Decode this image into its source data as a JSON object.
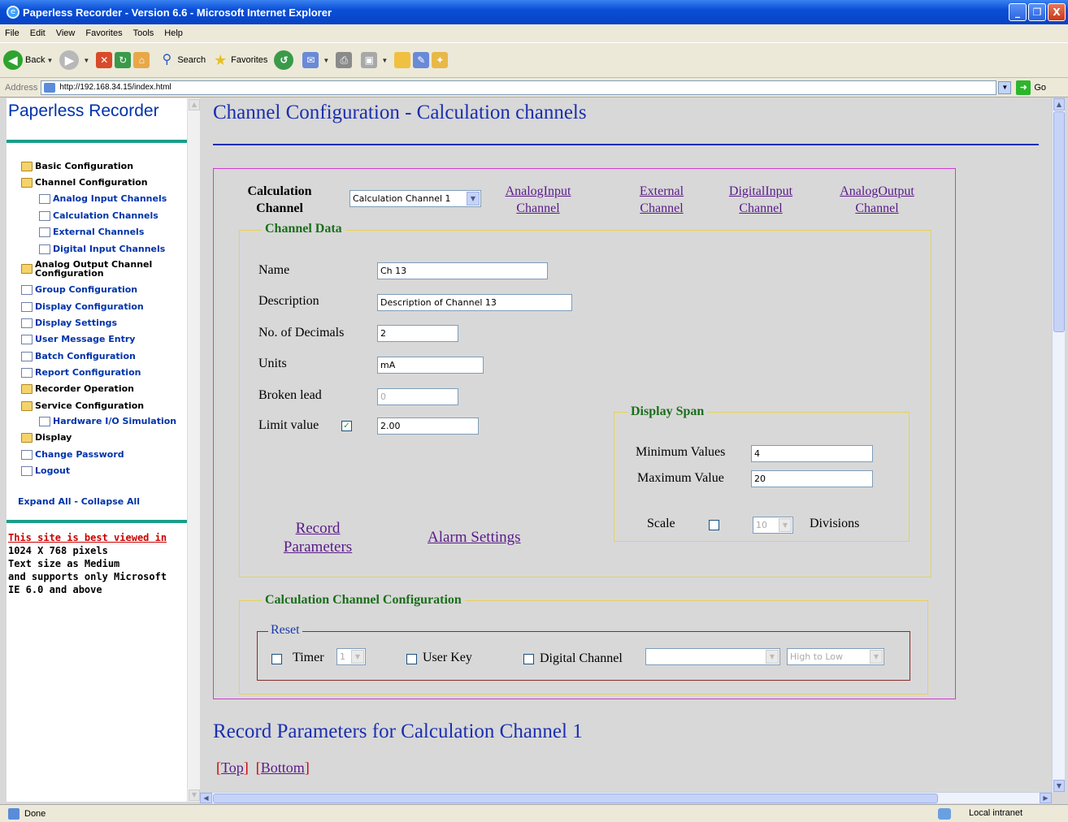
{
  "window": {
    "title": "Paperless Recorder - Version 6.6 - Microsoft Internet Explorer",
    "controls": {
      "minimize": "_",
      "maximize": "❐",
      "close": "X"
    }
  },
  "menubar": {
    "items": [
      "File",
      "Edit",
      "View",
      "Favorites",
      "Tools",
      "Help"
    ]
  },
  "toolbar": {
    "back": "Back",
    "search": "Search",
    "favorites": "Favorites"
  },
  "addressbar": {
    "label": "Address",
    "url": "http://192.168.34.15/index.html",
    "go": "Go"
  },
  "sidebar": {
    "title": "Paperless Recorder",
    "items": [
      {
        "label": "Basic Configuration",
        "icon": "folder-icon",
        "level": 0,
        "link": false
      },
      {
        "label": "Channel Configuration",
        "icon": "folder-icon",
        "level": 0,
        "link": false
      },
      {
        "label": "Analog Input Channels",
        "icon": "document-icon",
        "level": 1,
        "link": true
      },
      {
        "label": "Calculation Channels",
        "icon": "document-icon",
        "level": 1,
        "link": true
      },
      {
        "label": "External Channels",
        "icon": "document-icon",
        "level": 1,
        "link": true
      },
      {
        "label": "Digital Input Channels",
        "icon": "document-icon",
        "level": 1,
        "link": true
      },
      {
        "label": "Analog Output Channel Configuration",
        "icon": "folder-icon",
        "level": 0,
        "link": false
      },
      {
        "label": "Group Configuration",
        "icon": "document-icon",
        "level": 0,
        "link": true
      },
      {
        "label": "Display Configuration",
        "icon": "document-icon",
        "level": 0,
        "link": true
      },
      {
        "label": "Display Settings",
        "icon": "document-icon",
        "level": 0,
        "link": true
      },
      {
        "label": "User Message Entry",
        "icon": "document-icon",
        "level": 0,
        "link": true
      },
      {
        "label": "Batch Configuration",
        "icon": "document-icon",
        "level": 0,
        "link": true
      },
      {
        "label": "Report Configuration",
        "icon": "document-icon",
        "level": 0,
        "link": true
      },
      {
        "label": "Recorder Operation",
        "icon": "folder-icon",
        "level": 0,
        "link": false
      },
      {
        "label": "Service Configuration",
        "icon": "folder-icon",
        "level": 0,
        "link": false
      },
      {
        "label": "Hardware I/O Simulation",
        "icon": "document-icon",
        "level": 1,
        "link": true
      },
      {
        "label": "Display",
        "icon": "folder-icon",
        "level": 0,
        "link": false
      },
      {
        "label": "Change Password",
        "icon": "document-icon",
        "level": 0,
        "link": true
      },
      {
        "label": "Logout",
        "icon": "document-icon",
        "level": 0,
        "link": true
      }
    ],
    "expand_collapse": "Expand All - Collapse All",
    "notice": {
      "heading": "This site is best viewed in",
      "lines": [
        "1024 X 768 pixels",
        "Text size as Medium",
        "and supports only Microsoft",
        "IE 6.0 and above"
      ]
    }
  },
  "main": {
    "heading": "Channel Configuration - Calculation channels",
    "channel_selector": {
      "label_line1": "Calculation",
      "label_line2": "Channel",
      "value": "Calculation Channel 1"
    },
    "top_links": [
      {
        "line1": "AnalogInput",
        "line2": "Channel"
      },
      {
        "line1": "External",
        "line2": "Channel"
      },
      {
        "line1": "DigitalInput",
        "line2": "Channel"
      },
      {
        "line1": "AnalogOutput",
        "line2": "Channel"
      }
    ],
    "channel_data": {
      "legend": "Channel Data",
      "name_label": "Name",
      "name_value": "Ch 13",
      "description_label": "Description",
      "description_value": "Description of Channel 13",
      "decimals_label": "No. of Decimals",
      "decimals_value": "2",
      "units_label": "Units",
      "units_value": "mA",
      "broken_lead_label": "Broken lead",
      "broken_lead_value": "0",
      "limit_label": "Limit value",
      "limit_checked": true,
      "limit_value": "2.00",
      "record_params_line1": "Record",
      "record_params_line2": "Parameters",
      "alarm_settings": "Alarm Settings",
      "display_span": {
        "legend": "Display Span",
        "min_label": "Minimum Values",
        "min_value": "4",
        "max_label": "Maximum Value",
        "max_value": "20",
        "scale_label": "Scale",
        "scale_checked": false,
        "divisions_value": "10",
        "divisions_label": "Divisions"
      }
    },
    "calc_config": {
      "legend": "Calculation Channel Configuration",
      "reset": {
        "legend": "Reset",
        "timer_label": "Timer",
        "timer_value": "1",
        "user_key_label": "User Key",
        "digital_channel_label": "Digital Channel",
        "digital_channel_value": "",
        "edge_value": "High to Low"
      }
    },
    "record_heading": "Record Parameters for Calculation Channel 1",
    "nav": {
      "top": "Top",
      "bottom": "Bottom",
      "open": "[",
      "close": "]"
    }
  },
  "status": {
    "text": "Done",
    "zone": "Local intranet"
  }
}
